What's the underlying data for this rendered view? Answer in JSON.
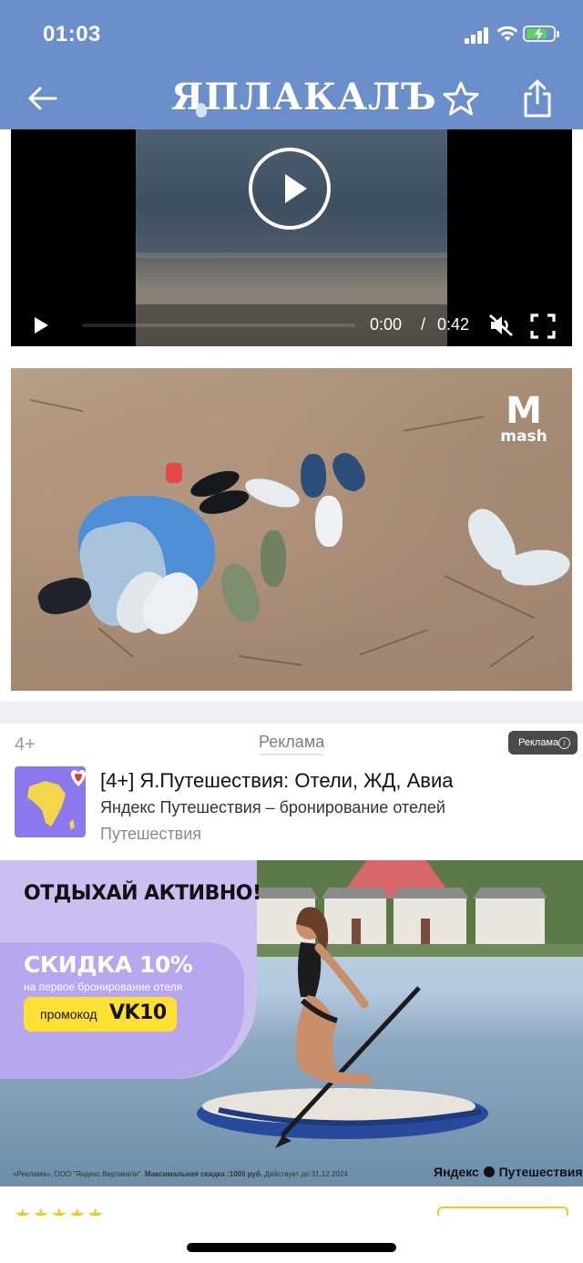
{
  "status_bar": {
    "time": "01:03",
    "battery_level": 0.8,
    "battery_color": "#5fd35f"
  },
  "header": {
    "logo_text": "ЯПЛАКАЛЪ",
    "back_icon": "back-arrow-icon",
    "favorite_icon": "star-outline-icon",
    "share_icon": "share-icon",
    "background": "#6a8fca"
  },
  "video": {
    "current_time": "0:00",
    "separator": "/",
    "duration": "0:42",
    "progress": 0,
    "muted": true
  },
  "photo": {
    "watermark": "mash"
  },
  "ad": {
    "age_rating": "4+",
    "tab_label": "Реклама",
    "badge_label": "Реклама",
    "info_icon": "info-icon",
    "title": "[4+] Я.Путешествия: Отели, ЖД, Авиа",
    "subtitle": "Яндекс Путешествия – бронирование отелей",
    "category": "Путешествия",
    "banner": {
      "slogan": "ОТДЫХАЙ АКТИВНО!",
      "discount": "СКИДКА 10%",
      "discount_note": "на первое бронирование отеля",
      "promo_label": "промокод",
      "promo_code": "VK10",
      "legal_prefix": "«Реклама», ООО \"Яндекс Вертикали\".",
      "legal_bold": "Максимальная скидка :1000 руб.",
      "legal_suffix": "Действует до 31.12.2024",
      "brand_left": "Яндекс",
      "brand_right": "Путешествия"
    },
    "stars": "★★★★★"
  }
}
